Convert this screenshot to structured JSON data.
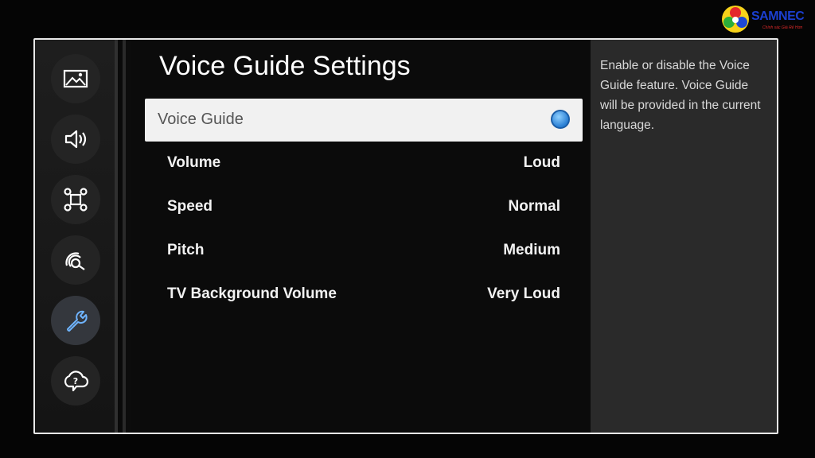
{
  "logo": {
    "name": "SAMNEC",
    "tagline": "Chính xác Giá Rẻ Hơn"
  },
  "sidebar": {
    "items": [
      {
        "icon": "picture-icon"
      },
      {
        "icon": "sound-icon"
      },
      {
        "icon": "broadcasting-icon"
      },
      {
        "icon": "network-icon"
      },
      {
        "icon": "general-icon",
        "active": true
      },
      {
        "icon": "support-icon"
      }
    ]
  },
  "main": {
    "title": "Voice Guide Settings",
    "selected_item": {
      "label": "Voice Guide",
      "enabled": true
    },
    "items": [
      {
        "label": "Volume",
        "value": "Loud"
      },
      {
        "label": "Speed",
        "value": "Normal"
      },
      {
        "label": "Pitch",
        "value": "Medium"
      },
      {
        "label": "TV Background Volume",
        "value": "Very Loud"
      }
    ]
  },
  "help": {
    "text": "Enable or disable the Voice Guide feature. Voice Guide will be provided in the current language."
  },
  "colors": {
    "toggle_on": "#2a7fd4",
    "help_bg": "#2a2a2a",
    "selected_bg": "#f1f1f1"
  }
}
